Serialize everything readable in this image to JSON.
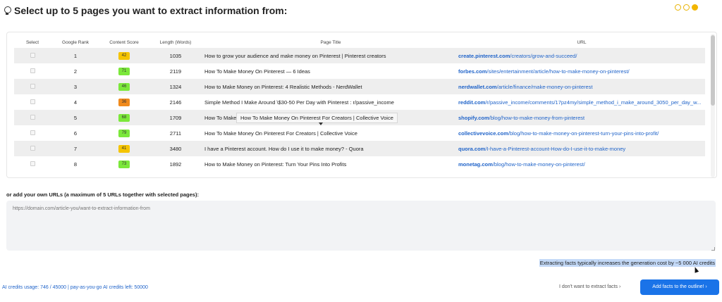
{
  "header": {
    "title": "Select up to 5 pages you want to extract information from:",
    "steps": [
      {
        "active": false
      },
      {
        "active": false
      },
      {
        "active": true
      }
    ]
  },
  "table": {
    "columns": [
      "Select",
      "Google Rank",
      "Content Score",
      "Length (Words)",
      "Page Title",
      "URL"
    ],
    "rows": [
      {
        "rank": "1",
        "score": "42",
        "score_color": "yellow",
        "length": "1035",
        "title": "How to grow your audience and make money on Pinterest | Pinterest creators",
        "url_domain": "create.pinterest.com",
        "url_path": "/creators/grow-and-succeed/"
      },
      {
        "rank": "2",
        "score": "71",
        "score_color": "green",
        "length": "2119",
        "title": "How To Make Money On Pinterest — 6 Ideas",
        "url_domain": "forbes.com",
        "url_path": "/sites/entertainment/article/how-to-make-money-on-pinterest/"
      },
      {
        "rank": "3",
        "score": "46",
        "score_color": "green",
        "length": "1324",
        "title": "How to Make Money on Pinterest: 4 Realistic Methods - NerdWallet",
        "url_domain": "nerdwallet.com",
        "url_path": "/article/finance/make-money-on-pinterest"
      },
      {
        "rank": "4",
        "score": "36",
        "score_color": "orange",
        "length": "2146",
        "title": "Simple Method I Make Around \\$30-50 Per Day with Pinterest : r/passive_income",
        "url_domain": "reddit.com",
        "url_path": "/r/passive_income/comments/17pz4my/simple_method_i_make_around_3050_per_day_w..."
      },
      {
        "rank": "5",
        "score": "68",
        "score_color": "green",
        "length": "1709",
        "title": "How To Make |",
        "url_domain": "shopify.com",
        "url_path": "/blog/how-to-make-money-from-pinterest"
      },
      {
        "rank": "6",
        "score": "79",
        "score_color": "green",
        "length": "2711",
        "title": "How To Make Money On Pinterest For Creators | Collective Voice",
        "url_domain": "collectivevoice.com",
        "url_path": "/blog/how-to-make-money-on-pinterest-turn-your-pins-into-profit/"
      },
      {
        "rank": "7",
        "score": "41",
        "score_color": "yellow",
        "length": "3480",
        "title": "I have a Pinterest account. How do I use it to make money? - Quora",
        "url_domain": "quora.com",
        "url_path": "/I-have-a-Pinterest-account-How-do-I-use-it-to-make-money"
      },
      {
        "rank": "8",
        "score": "73",
        "score_color": "green",
        "length": "1892",
        "title": "How to Make Money on Pinterest: Turn Your Pins Into Profits",
        "url_domain": "monetag.com",
        "url_path": "/blog/how-to-make-money-on-pinterest/"
      }
    ],
    "tooltip": "How To Make Money On Pinterest For Creators | Collective Voice"
  },
  "own_urls": {
    "label": "or add your own URLs (a maximum of 5 URLs together with selected pages):",
    "placeholder": "https://domain.com/article-you/want-to-extract-information-from"
  },
  "footer": {
    "cost_note": "Extracting facts typically increases the generation cost by ~5 000 AI credits",
    "credits_usage": "AI credits usage: 746 / 45000 | pay-as-you-go AI credits left: 50000",
    "no_extract_label": "I don't want to extract facts ›",
    "add_button_label": "Add facts to the outline! ›"
  }
}
